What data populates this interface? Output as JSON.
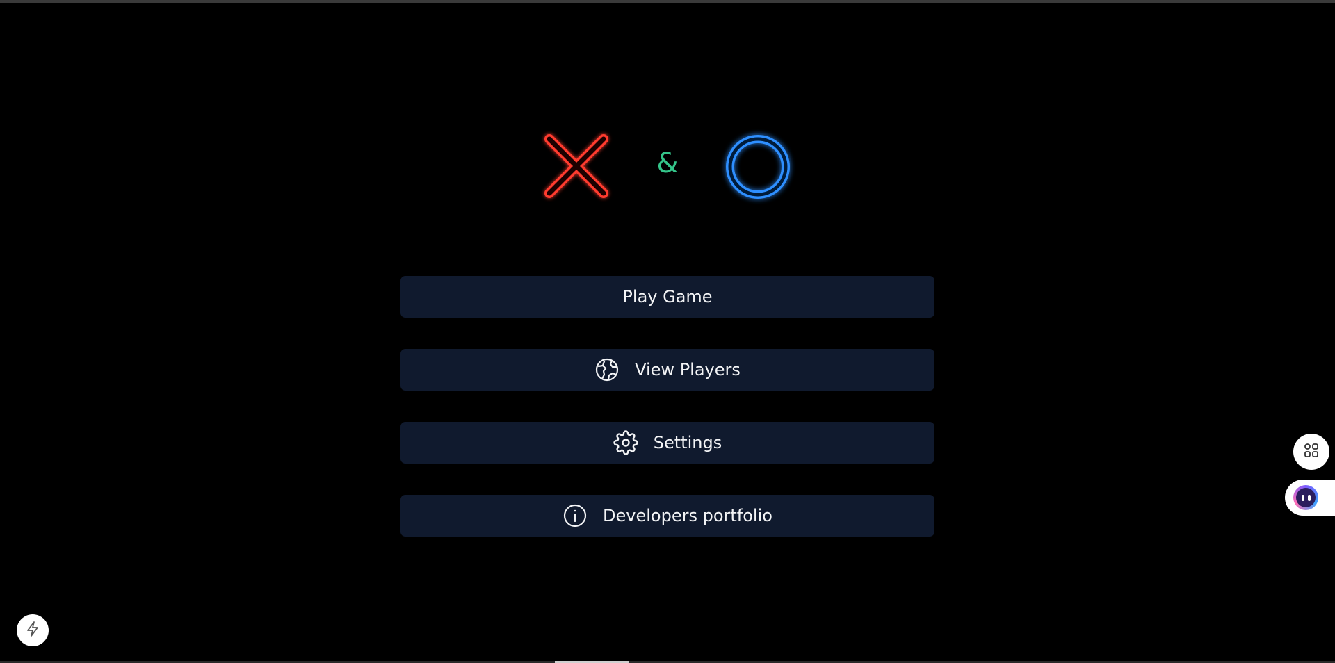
{
  "logo": {
    "ampersand": "&",
    "x_color": "#ff3b2f",
    "o_color": "#2f8fff",
    "amp_color": "#34c58a"
  },
  "menu": {
    "items": [
      {
        "label": "Play Game",
        "icon": ""
      },
      {
        "label": "View Players",
        "icon": "globe-icon"
      },
      {
        "label": "Settings",
        "icon": "gear-icon"
      },
      {
        "label": "Developers portfolio",
        "icon": "info-icon"
      }
    ],
    "button_color": "#101a2e"
  },
  "widgets": {
    "left": "lightning-icon",
    "right_top": "grid-icon",
    "right_bottom": "assistant-bot-icon"
  }
}
